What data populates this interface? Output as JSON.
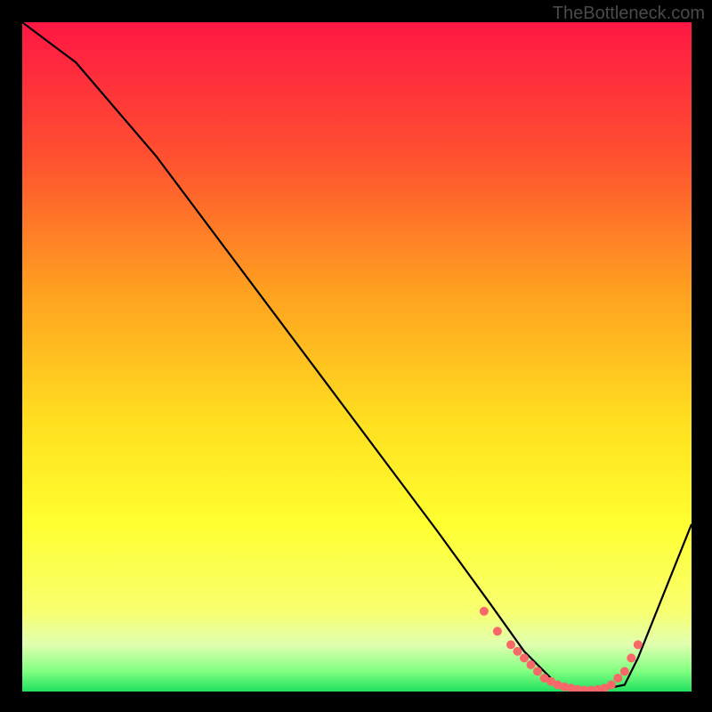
{
  "watermark": "TheBottleneck.com",
  "chart_data": {
    "type": "line",
    "title": "",
    "xlabel": "",
    "ylabel": "",
    "xlim": [
      0,
      100
    ],
    "ylim": [
      0,
      100
    ],
    "gradient_stops": [
      {
        "offset": 0,
        "color": "#ff1744"
      },
      {
        "offset": 20,
        "color": "#ff5030"
      },
      {
        "offset": 40,
        "color": "#ffa020"
      },
      {
        "offset": 60,
        "color": "#ffe020"
      },
      {
        "offset": 75,
        "color": "#ffff30"
      },
      {
        "offset": 88,
        "color": "#f8ff70"
      },
      {
        "offset": 93,
        "color": "#e0ffb0"
      },
      {
        "offset": 97,
        "color": "#80ff80"
      },
      {
        "offset": 100,
        "color": "#20e060"
      }
    ],
    "series": [
      {
        "name": "curve",
        "type": "line",
        "color": "#000000",
        "x": [
          0,
          4,
          8,
          20,
          35,
          50,
          62,
          70,
          75,
          80,
          85,
          90,
          92,
          100
        ],
        "values": [
          100,
          97,
          94,
          80,
          60,
          40,
          24,
          13,
          6,
          1,
          0,
          1,
          5,
          25
        ]
      },
      {
        "name": "markers",
        "type": "scatter",
        "color": "#f86868",
        "x": [
          69,
          71,
          73,
          74,
          75,
          76,
          77,
          78,
          79,
          80,
          81,
          82,
          83,
          84,
          85,
          86,
          87,
          88,
          89,
          90,
          91,
          92
        ],
        "values": [
          12,
          9,
          7,
          6,
          5,
          4,
          3,
          2,
          1.5,
          1,
          0.7,
          0.5,
          0.3,
          0.2,
          0.2,
          0.3,
          0.5,
          1,
          2,
          3,
          5,
          7
        ]
      }
    ]
  }
}
